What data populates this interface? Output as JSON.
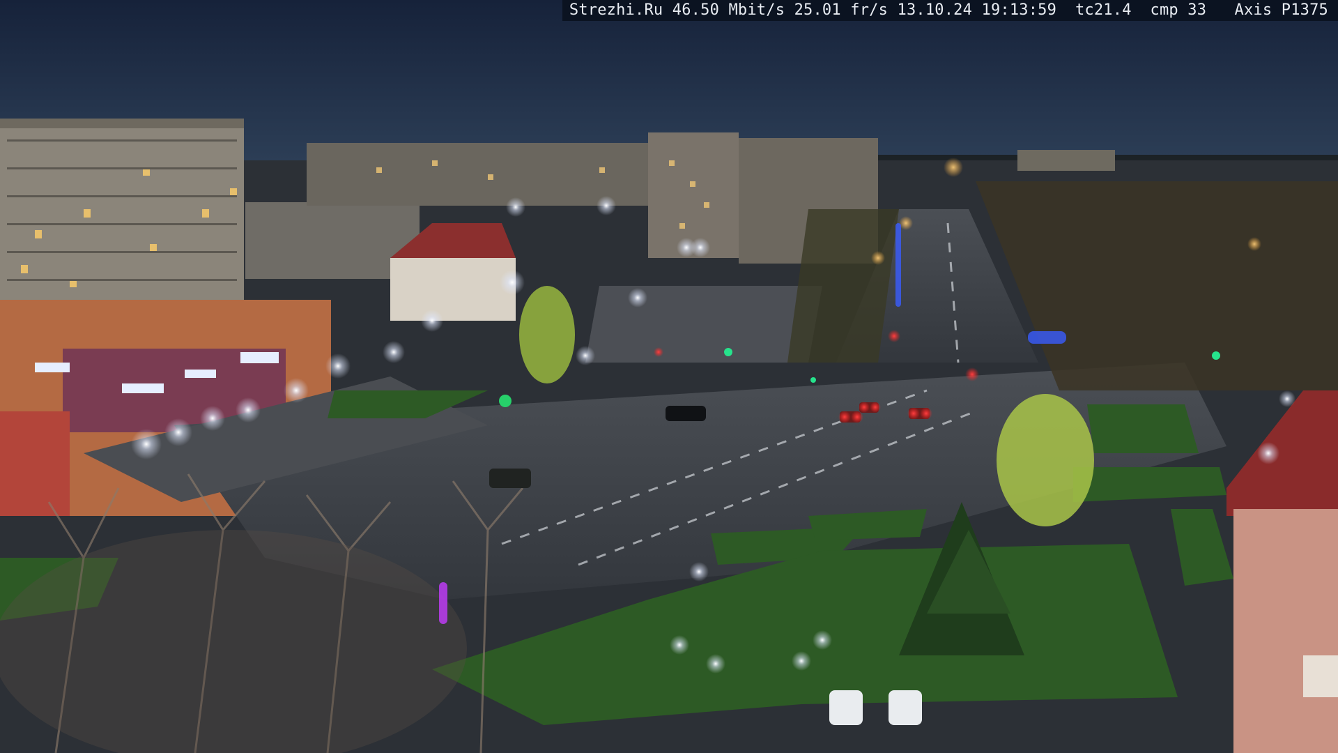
{
  "overlay": {
    "site": "Strezhi.Ru",
    "bitrate": "46.50 Mbit/s",
    "framerate": "25.01 fr/s",
    "date": "13.10.24",
    "time": "19:13:59",
    "tc": "tc21.4",
    "cmp": "cmp 33",
    "camera": "Axis P1375"
  },
  "colors": {
    "sky_top": "#1a2640",
    "sky_horizon": "#2c3f58",
    "road": "#3a3f47",
    "grass": "#2f5a26",
    "building_panel": "#8a8478",
    "building_red": "#8c3a34",
    "street_light": "#f3f6ff",
    "tail_light": "#ff2a2a",
    "green_signal": "#24e08a"
  }
}
